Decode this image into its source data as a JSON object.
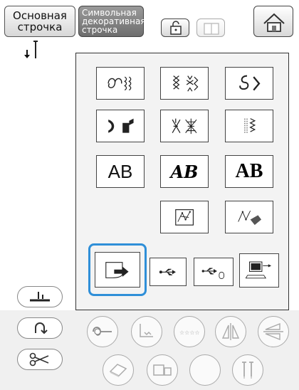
{
  "header": {
    "tab_basic": [
      "Основная",
      "строчка"
    ],
    "tab_char": [
      "Символьная",
      "декоративная",
      "строчка"
    ]
  },
  "panel": {
    "tiles": [
      {
        "name": "decorative-pattern-1",
        "icon": "flourish-icon"
      },
      {
        "name": "decorative-pattern-2",
        "icon": "cross-stitch-icon"
      },
      {
        "name": "decorative-pattern-3",
        "icon": "swirl-icon"
      },
      {
        "name": "satin-stitch",
        "icon": "satin-icon"
      },
      {
        "name": "cross-stitch",
        "icon": "cross-icon"
      },
      {
        "name": "utility-decorative",
        "icon": "zigzag-icon"
      },
      {
        "name": "font-ab-sans",
        "text": "AB"
      },
      {
        "name": "font-ab-script",
        "text": "AB"
      },
      {
        "name": "font-ab-serif",
        "text": "AB"
      },
      {
        "name": "my-custom-stitch",
        "icon": "custom-stitch-icon"
      },
      {
        "name": "stored-pattern",
        "icon": "stitch-pen-icon"
      }
    ],
    "storage": [
      {
        "name": "machine-memory",
        "icon": "pocket-arrow-icon",
        "selected": true
      },
      {
        "name": "usb-1",
        "icon": "usb-icon"
      },
      {
        "name": "usb-mouse",
        "icon": "usb-mouse-icon"
      },
      {
        "name": "usb-computer",
        "icon": "usb-computer-icon"
      }
    ]
  },
  "left_controls": {
    "needle_position": "needle-down-icon"
  },
  "colors": {
    "highlight": "#2f8fd8"
  }
}
